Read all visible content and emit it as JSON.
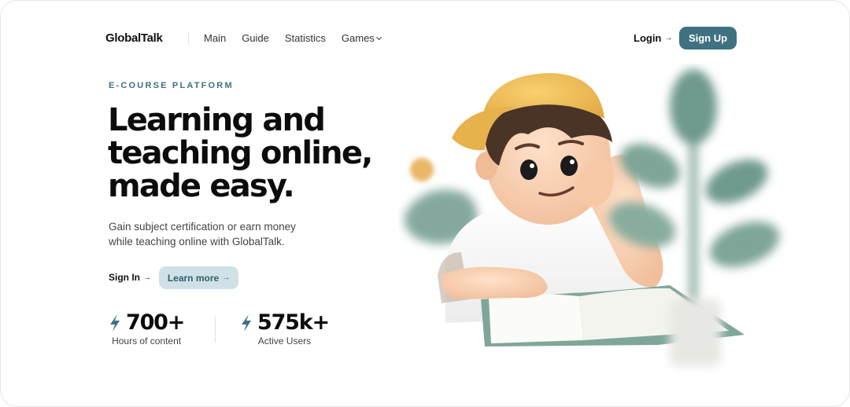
{
  "brand": {
    "name": "GlobalTalk"
  },
  "nav": {
    "items": [
      {
        "label": "Main"
      },
      {
        "label": "Guide"
      },
      {
        "label": "Statistics"
      },
      {
        "label": "Games",
        "has_dropdown": true
      }
    ],
    "login_label": "Login",
    "signup_label": "Sign Up"
  },
  "hero": {
    "eyebrow": "E-COURSE PLATFORM",
    "headline_lines": [
      "Learning and",
      "teaching online,",
      "made easy."
    ],
    "subtext_lines": [
      "Gain subject certification or earn money",
      "while teaching online with GlobalTalk."
    ],
    "signin_label": "Sign In",
    "learn_more_label": "Learn more",
    "arrow_glyph": "→"
  },
  "stats": [
    {
      "value": "700+",
      "label": "Hours of content",
      "icon": "lightning-bolt-icon"
    },
    {
      "value": "575k+",
      "label": "Active Users",
      "icon": "lightning-bolt-icon"
    }
  ],
  "colors": {
    "accent": "#3f7280",
    "accent_light": "#cfe1e6",
    "text_dark": "#0c0c0c",
    "cap": "#f2c15a",
    "plant": "#6f9a8e"
  },
  "illustration": {
    "subject": "3d-boy-reading-book-illustration",
    "elements": [
      "yellow-cap",
      "open-book",
      "blurred-plant",
      "blurred-ball",
      "blurred-stone"
    ]
  }
}
